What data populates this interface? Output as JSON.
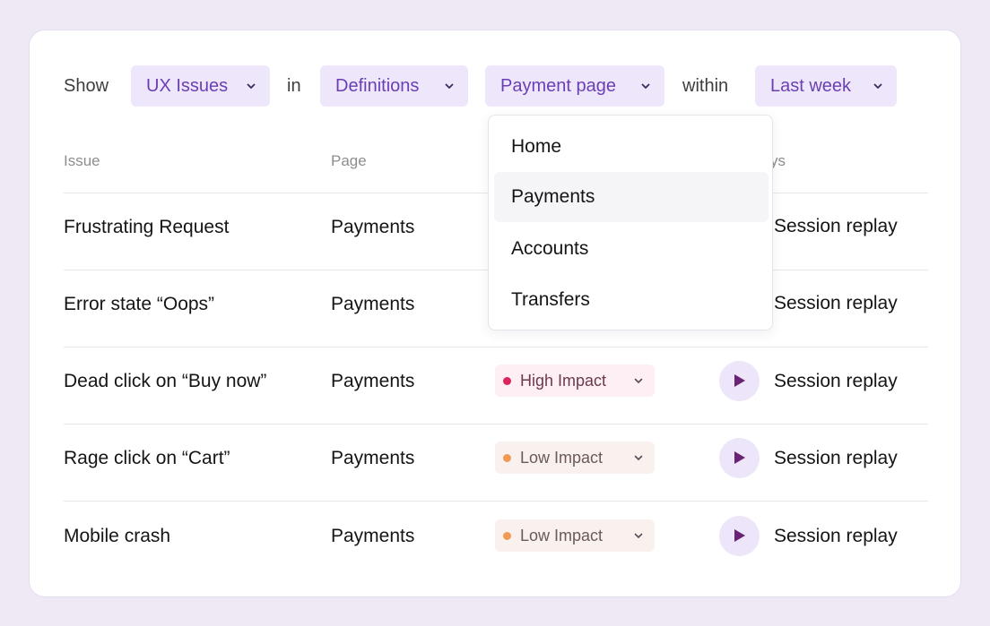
{
  "filters": {
    "show_label": "Show",
    "type_value": "UX Issues",
    "in_label": "in",
    "category_value": "Definitions",
    "page_value": "Payment page",
    "within_label": "within",
    "period_value": "Last week"
  },
  "table": {
    "headers": {
      "issue": "Issue",
      "page": "Page",
      "replays_partial": "ys"
    },
    "rows": [
      {
        "issue": "Frustrating Request",
        "page": "Payments",
        "impact": "",
        "replay": "Session replay"
      },
      {
        "issue": "Error state “Oops”",
        "page": "Payments",
        "impact": "",
        "replay": "Session replay"
      },
      {
        "issue": "Dead click on “Buy now”",
        "page": "Payments",
        "impact": "High Impact",
        "replay": "Session replay"
      },
      {
        "issue": "Rage click on “Cart”",
        "page": "Payments",
        "impact": "Low Impact",
        "replay": "Session replay"
      },
      {
        "issue": "Mobile crash",
        "page": "Payments",
        "impact": "Low Impact",
        "replay": "Session replay"
      }
    ]
  },
  "dropdown": {
    "items": [
      "Home",
      "Payments",
      "Accounts",
      "Transfers"
    ],
    "highlighted": "Payments"
  },
  "colors": {
    "accent": "#6b3fb4",
    "pill_bg": "#eee7fb",
    "high_impact_dot": "#d9245c",
    "low_impact_dot": "#f39a52",
    "play_icon": "#6a2374",
    "background": "#efe9f6"
  },
  "icons": [
    "chevron-down-icon",
    "play-icon",
    "status-dot-icon"
  ]
}
